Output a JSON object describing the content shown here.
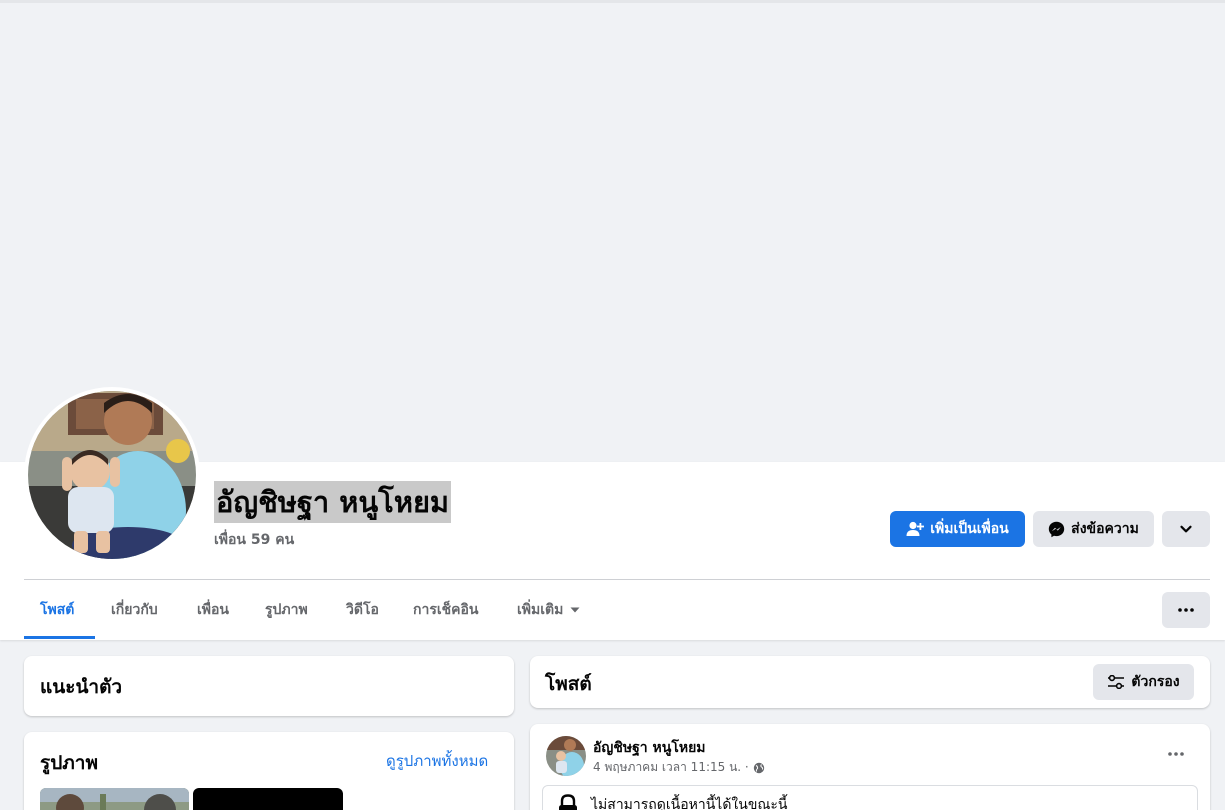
{
  "profile": {
    "name": "อัญชิษฐา หนูโหยม",
    "friends": "เพื่อน 59 คน"
  },
  "actions": {
    "add_friend": "เพิ่มเป็นเพื่อน",
    "message": "ส่งข้อความ"
  },
  "tabs": [
    {
      "label": "โพสต์",
      "active": true
    },
    {
      "label": "เกี่ยวกับ"
    },
    {
      "label": "เพื่อน"
    },
    {
      "label": "รูปภาพ"
    },
    {
      "label": "วิดีโอ"
    },
    {
      "label": "การเช็คอิน"
    },
    {
      "label": "เพิ่มเติม"
    }
  ],
  "intro": {
    "title": "แนะนำตัว"
  },
  "photos": {
    "title": "รูปภาพ",
    "see_all": "ดูรูปภาพทั้งหมด"
  },
  "posts_header": {
    "title": "โพสต์",
    "filter": "ตัวกรอง"
  },
  "post": {
    "author": "อัญชิษฐา หนูโหยม",
    "meta": "4 พฤษภาคม เวลา 11:15 น. ·",
    "notice": "ไม่สามารถดูเนื้อหานี้ได้ในขณะนี้"
  },
  "colors": {
    "accent": "#1b74e4",
    "page_bg": "#f0f2f5",
    "secondary_button": "#e4e6eb"
  },
  "icons": [
    "add-friend-icon",
    "messenger-icon",
    "chevron-down-icon",
    "more-dots-icon",
    "filter-icon",
    "globe-icon",
    "lock-icon"
  ]
}
